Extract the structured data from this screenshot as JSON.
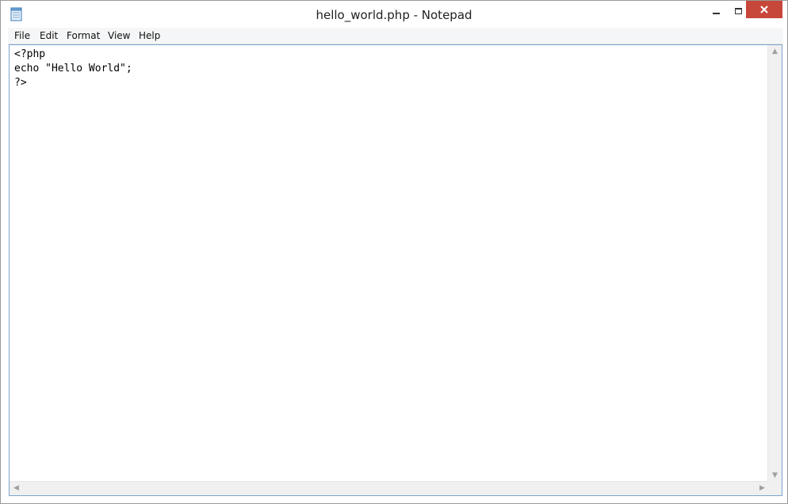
{
  "window": {
    "title": "hello_world.php - Notepad"
  },
  "menu": {
    "items": [
      {
        "label": "File"
      },
      {
        "label": "Edit"
      },
      {
        "label": "Format"
      },
      {
        "label": "View"
      },
      {
        "label": "Help"
      }
    ]
  },
  "editor": {
    "content": "<?php\necho \"Hello World\";\n?>"
  },
  "icons": {
    "app": "notepad-icon",
    "minimize": "minimize-icon",
    "maximize": "maximize-icon",
    "close": "close-icon"
  },
  "colors": {
    "close_button": "#c7473a",
    "editor_border": "#7aa4cf"
  }
}
